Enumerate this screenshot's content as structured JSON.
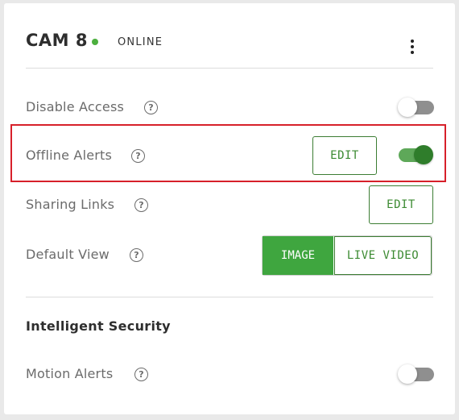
{
  "header": {
    "camera_name": "CAM 8",
    "status": "ONLINE",
    "status_color": "#4caf3e",
    "menu_icon": "kebab-menu-icon"
  },
  "settings": {
    "disable_access": {
      "label": "Disable Access",
      "help": "?",
      "enabled": false
    },
    "offline_alerts": {
      "label": "Offline Alerts",
      "help": "?",
      "edit_label": "EDIT",
      "enabled": true
    },
    "sharing_links": {
      "label": "Sharing Links",
      "help": "?",
      "edit_label": "EDIT"
    },
    "default_view": {
      "label": "Default View",
      "help": "?",
      "options": [
        "IMAGE",
        "LIVE VIDEO"
      ],
      "selected": "IMAGE"
    }
  },
  "intelligent_security": {
    "title": "Intelligent Security",
    "motion_alerts": {
      "label": "Motion Alerts",
      "help": "?",
      "enabled": false
    }
  },
  "colors": {
    "accent_green": "#3fa63f",
    "toggle_on": "#2f7d2b",
    "highlight_red": "#d7202a"
  }
}
